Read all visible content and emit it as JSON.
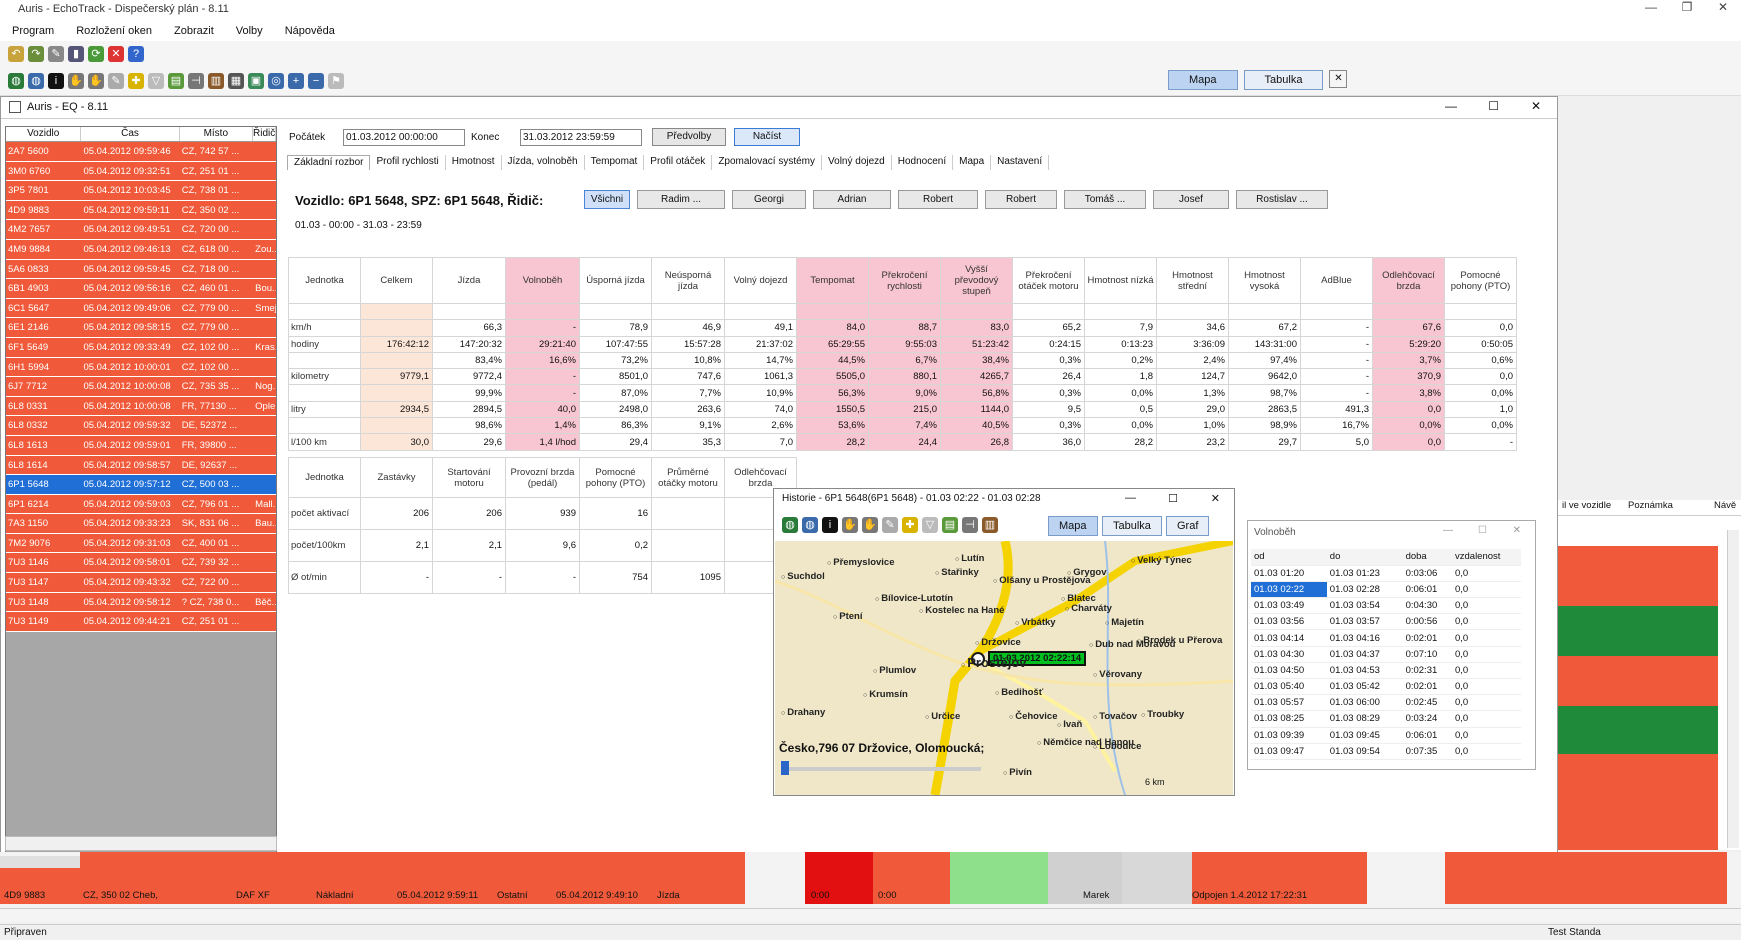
{
  "app": {
    "title": "Auris - EchoTrack - Dispečerský plán - 8.11"
  },
  "menu": [
    "Program",
    "Rozložení oken",
    "Zobrazit",
    "Volby",
    "Nápověda"
  ],
  "view_tabs": {
    "map": "Mapa",
    "table": "Tabulka"
  },
  "inner": {
    "title": "Auris - EQ - 8.11"
  },
  "vehicle_list": {
    "headers": [
      "Vozidlo",
      "Čas",
      "Místo",
      "Řidič"
    ],
    "rows": [
      [
        "2A7 5600",
        "05.04.2012 09:59:46",
        "CZ, 742 57 ...",
        ""
      ],
      [
        "3M0 6760",
        "05.04.2012 09:32:51",
        "CZ, 251 01 ...",
        ""
      ],
      [
        "3P5 7801",
        "05.04.2012 10:03:45",
        "CZ, 738 01 ...",
        ""
      ],
      [
        "4D9 9883",
        "05.04.2012 09:59:11",
        "CZ, 350 02 ...",
        ""
      ],
      [
        "4M2 7657",
        "05.04.2012 09:49:51",
        "CZ, 720 00 ...",
        ""
      ],
      [
        "4M9 9884",
        "05.04.2012 09:46:13",
        "CZ, 618 00 ...",
        "Zou..."
      ],
      [
        "5A6 0833",
        "05.04.2012 09:59:45",
        "CZ, 718 00 ...",
        ""
      ],
      [
        "6B1 4903",
        "05.04.2012 09:56:16",
        "CZ, 460 01 ...",
        "Bou..."
      ],
      [
        "6C1 5647",
        "05.04.2012 09:49:06",
        "CZ, 779 00 ...",
        "Smej..."
      ],
      [
        "6E1 2146",
        "05.04.2012 09:58:15",
        "CZ, 779 00 ...",
        ""
      ],
      [
        "6F1 5649",
        "05.04.2012 09:33:49",
        "CZ, 102 00 ...",
        "Kras..."
      ],
      [
        "6H1 5994",
        "05.04.2012 10:00:01",
        "CZ, 102 00 ...",
        ""
      ],
      [
        "6J7 7712",
        "05.04.2012 10:00:08",
        "CZ, 735 35 ...",
        "Nog..."
      ],
      [
        "6L8 0331",
        "05.04.2012 10:00:08",
        "FR, 77130 ...",
        "Ople..."
      ],
      [
        "6L8 0332",
        "05.04.2012 09:59:32",
        "DE, 52372 ...",
        ""
      ],
      [
        "6L8 1613",
        "05.04.2012 09:59:01",
        "FR, 39800 ...",
        ""
      ],
      [
        "6L8 1614",
        "05.04.2012 09:58:57",
        "DE, 92637 ...",
        ""
      ],
      [
        "6P1 5648",
        "05.04.2012 09:57:12",
        "CZ, 500 03 ...",
        ""
      ],
      [
        "6P1 6214",
        "05.04.2012 09:59:03",
        "CZ, 796 01 ...",
        "Mall..."
      ],
      [
        "7A3 1150",
        "05.04.2012 09:33:23",
        "SK, 831 06 ...",
        "Bau..."
      ],
      [
        "7M2 9076",
        "05.04.2012 09:31:03",
        "CZ, 400 01 ...",
        ""
      ],
      [
        "7U3 1146",
        "05.04.2012 09:58:01",
        "CZ, 739 32 ...",
        ""
      ],
      [
        "7U3 1147",
        "05.04.2012 09:43:32",
        "CZ, 722 00 ...",
        ""
      ],
      [
        "7U3 1148",
        "05.04.2012 09:58:12",
        "? CZ, 738 0...",
        "Běč..."
      ],
      [
        "7U3 1149",
        "05.04.2012 09:44:21",
        "CZ, 251 01 ...",
        ""
      ]
    ],
    "selected": 17
  },
  "filter": {
    "start_label": "Počátek",
    "start_value": "01.03.2012 00:00:00",
    "end_label": "Konec",
    "end_value": "31.03.2012 23:59:59",
    "presets": "Předvolby",
    "load": "Načíst"
  },
  "subtabs": [
    "Základní rozbor",
    "Profil rychlosti",
    "Hmotnost",
    "Jízda, volnoběh",
    "Tempomat",
    "Profil otáček",
    "Zpomalovací systémy",
    "Volný dojezd",
    "Hodnocení",
    "Mapa",
    "Nastavení"
  ],
  "vehicle_heading": "Vozidlo: 6P1 5648, SPZ: 6P1 5648, Řidič:",
  "period": "01.03 - 00:00 - 31.03 - 23:59",
  "drivers": [
    "Všichni",
    "Radim ...",
    "Georgi",
    "Adrian",
    "Robert",
    "Robert",
    "Tomáš ...",
    "Josef",
    "Rostislav ..."
  ],
  "stats": {
    "headers": [
      "Jednotka",
      "Celkem",
      "Jízda",
      "Volnoběh",
      "Úsporná jízda",
      "Neúsporná jízda",
      "Volný dojezd",
      "Tempomat",
      "Překročení rychlosti",
      "Vyšší převodový stupeň",
      "Překročení otáček motoru",
      "Hmotnost nízká",
      "Hmotnost střední",
      "Hmotnost vysoká",
      "AdBlue",
      "Odlehčovací brzda",
      "Pomocné pohony (PTO)"
    ],
    "rows": [
      [
        "",
        "",
        "",
        "",
        "",
        "",
        "",
        "",
        "",
        "",
        "",
        "",
        "",
        "",
        "",
        "",
        ""
      ],
      [
        "km/h",
        "",
        "66,3",
        "-",
        "78,9",
        "46,9",
        "49,1",
        "84,0",
        "88,7",
        "83,0",
        "65,2",
        "7,9",
        "34,6",
        "67,2",
        "-",
        "67,6",
        "0,0"
      ],
      [
        "hodiny",
        "176:42:12",
        "147:20:32",
        "29:21:40",
        "107:47:55",
        "15:57:28",
        "21:37:02",
        "65:29:55",
        "9:55:03",
        "51:23:42",
        "0:24:15",
        "0:13:23",
        "3:36:09",
        "143:31:00",
        "-",
        "5:29:20",
        "0:50:05"
      ],
      [
        "",
        "",
        "83,4%",
        "16,6%",
        "73,2%",
        "10,8%",
        "14,7%",
        "44,5%",
        "6,7%",
        "38,4%",
        "0,3%",
        "0,2%",
        "2,4%",
        "97,4%",
        "-",
        "3,7%",
        "0,6%"
      ],
      [
        "kilometry",
        "9779,1",
        "9772,4",
        "-",
        "8501,0",
        "747,6",
        "1061,3",
        "5505,0",
        "880,1",
        "4265,7",
        "26,4",
        "1,8",
        "124,7",
        "9642,0",
        "-",
        "370,9",
        "0,0"
      ],
      [
        "",
        "",
        "99,9%",
        "-",
        "87,0%",
        "7,7%",
        "10,9%",
        "56,3%",
        "9,0%",
        "56,8%",
        "0,3%",
        "0,0%",
        "1,3%",
        "98,7%",
        "-",
        "3,8%",
        "0,0%"
      ],
      [
        "litry",
        "2934,5",
        "2894,5",
        "40,0",
        "2498,0",
        "263,6",
        "74,0",
        "1550,5",
        "215,0",
        "1144,0",
        "9,5",
        "0,5",
        "29,0",
        "2863,5",
        "491,3",
        "0,0",
        "1,0"
      ],
      [
        "",
        "",
        "98,6%",
        "1,4%",
        "86,3%",
        "9,1%",
        "2,6%",
        "53,6%",
        "7,4%",
        "40,5%",
        "0,3%",
        "0,0%",
        "1,0%",
        "98,9%",
        "16,7%",
        "0,0%",
        "0,0%"
      ],
      [
        "l/100 km",
        "30,0",
        "29,6",
        "1,4 l/hod",
        "29,4",
        "35,3",
        "7,0",
        "28,2",
        "24,4",
        "26,8",
        "36,0",
        "28,2",
        "23,2",
        "29,7",
        "5,0",
        "0,0",
        "-"
      ]
    ]
  },
  "stats2": {
    "headers": [
      "Jednotka",
      "Zastávky",
      "Startování motoru",
      "Provozní brzda (pedál)",
      "Pomocné pohony (PTO)",
      "Průměrné otáčky motoru",
      "Odlehčovací brzda"
    ],
    "rows": [
      [
        "počet aktivací",
        "206",
        "206",
        "939",
        "16",
        "",
        ""
      ],
      [
        "počet/100km",
        "2,1",
        "2,1",
        "9,6",
        "0,2",
        "",
        ""
      ],
      [
        "Ø ot/min",
        "-",
        "-",
        "-",
        "754",
        "1095",
        ""
      ]
    ]
  },
  "history": {
    "title": "Historie - 6P1 5648(6P1 5648) - 01.03 02:22 - 01.03 02:28",
    "tabs": [
      "Mapa",
      "Tabulka",
      "Graf"
    ],
    "marker": "01.03.2012 02:22:14",
    "address": "Česko,796 07 Držovice, Olomoucká;",
    "scale": "6 km",
    "towns": [
      "Přemyslovice",
      "Lutín",
      "Velký Týnec",
      "Suchdol",
      "Stařinky",
      "Olšany u Prostějova",
      "Grygov",
      "Blatec",
      "Charváty",
      "Bílovice-Lutotín",
      "Kostelec na Hané",
      "Vrbátky",
      "Majetín",
      "Ptení",
      "Držovice",
      "Dub nad Moravou",
      "Brodek u Přerova",
      "Prostějov",
      "Plumlov",
      "Věrovany",
      "Krumsín",
      "Bedihošť",
      "Drahany",
      "Určice",
      "Čehovice",
      "Tovačov",
      "Troubky",
      "Ivaň",
      "Lobodice",
      "Němčice nad Hanou",
      "Pivín"
    ]
  },
  "idle": {
    "title": "Volnoběh",
    "headers": [
      "od",
      "do",
      "doba",
      "vzdalenost"
    ],
    "rows": [
      [
        "01.03 01:20",
        "01.03 01:23",
        "0:03:06",
        "0,0"
      ],
      [
        "01.03 02:22",
        "01.03 02:28",
        "0:06:01",
        "0,0"
      ],
      [
        "01.03 03:49",
        "01.03 03:54",
        "0:04:30",
        "0,0"
      ],
      [
        "01.03 03:56",
        "01.03 03:57",
        "0:00:56",
        "0,0"
      ],
      [
        "01.03 04:14",
        "01.03 04:16",
        "0:02:01",
        "0,0"
      ],
      [
        "01.03 04:30",
        "01.03 04:37",
        "0:07:10",
        "0,0"
      ],
      [
        "01.03 04:50",
        "01.03 04:53",
        "0:02:31",
        "0,0"
      ],
      [
        "01.03 05:40",
        "01.03 05:42",
        "0:02:01",
        "0,0"
      ],
      [
        "01.03 05:57",
        "01.03 06:00",
        "0:02:45",
        "0,0"
      ],
      [
        "01.03 08:25",
        "01.03 08:29",
        "0:03:24",
        "0,0"
      ],
      [
        "01.03 09:39",
        "01.03 09:45",
        "0:06:01",
        "0,0"
      ],
      [
        "01.03 09:47",
        "01.03 09:54",
        "0:07:35",
        "0,0"
      ]
    ]
  },
  "right_panel": {
    "col1": "il ve vozidle",
    "col2": "Poznámka",
    "col3": "Návě"
  },
  "bottom_row": [
    "4D9 9883",
    "CZ, 350 02 Cheb,",
    "DAF XF",
    "Nákladní",
    "05.04.2012 9:59:11",
    "Ostatní",
    "05.04.2012 9:49:10",
    "Jízda",
    "0:00",
    "0:00",
    "Marek",
    "Odpojen 1.4.2012 17:22:31"
  ],
  "status": {
    "left": "Připraven",
    "right": "Test Standa"
  }
}
